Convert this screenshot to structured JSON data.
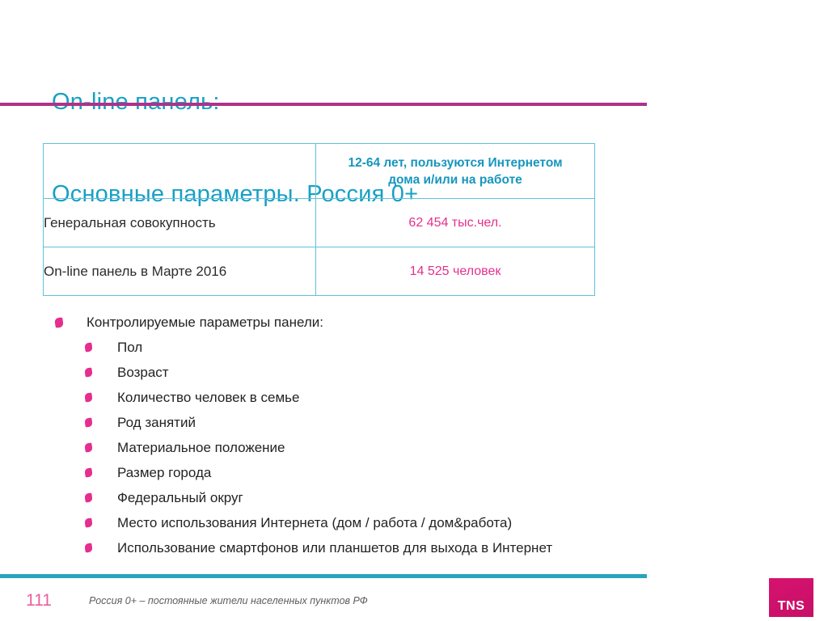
{
  "slide": {
    "title_line_1": "On-line панель:",
    "title_line_2": "Основные параметры. Россия 0+",
    "title_color": "#18A0C4",
    "rule_color": "#AF3189"
  },
  "table": {
    "header": {
      "label_cell": "",
      "value_line_1": "12-64 лет, пользуются Интернетом",
      "value_line_2": "дома и/или на работе"
    },
    "rows": [
      {
        "label": "Генеральная совокупность",
        "value": "62 454 тыс.чел."
      },
      {
        "label": "On-line панель в Марте 2016",
        "value": "14 525 человек"
      }
    ],
    "border_color": "#5FC2DA",
    "header_text_color": "#1696BE",
    "value_text_color": "#E5308C"
  },
  "bullets": {
    "heading": "Контролируемые параметры панели:",
    "items": [
      "Пол",
      "Возраст",
      "Количество человек в семье",
      "Род занятий",
      "Материальное положение",
      "Размер города",
      "Федеральный округ",
      "Место использования Интернета (дом / работа / дом&работа)",
      "Использование смартфонов или планшетов для выхода в Интернет"
    ],
    "marker_color": "#E52E8E"
  },
  "footer": {
    "page_number": "111",
    "note": "Россия 0+ – постоянные жители населенных пунктов РФ",
    "rule_color": "#2AA3BE",
    "logo_text": "TNS",
    "logo_color": "#CE0F6B"
  }
}
